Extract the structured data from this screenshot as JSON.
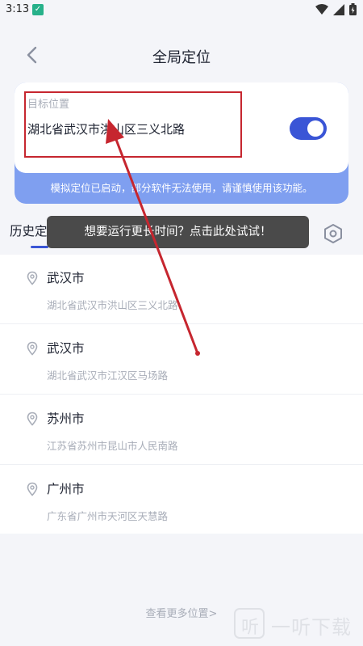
{
  "status_bar": {
    "time": "3:13"
  },
  "header": {
    "title": "全局定位"
  },
  "target": {
    "label": "目标位置",
    "address": "湖北省武汉市洪山区三义北路",
    "toggle_on": true
  },
  "notice": "模拟定位已启动，部分软件无法使用，请谨慎使用该功能。",
  "tabs": {
    "history": "历史定位"
  },
  "tooltip": "想要运行更长时间？点击此处试试！",
  "history": [
    {
      "city": "武汉市",
      "detail": "湖北省武汉市洪山区三义北路"
    },
    {
      "city": "武汉市",
      "detail": "湖北省武汉市江汉区马场路"
    },
    {
      "city": "苏州市",
      "detail": "江苏省苏州市昆山市人民南路"
    },
    {
      "city": "广州市",
      "detail": "广东省广州市天河区天慧路"
    }
  ],
  "more_link": "查看更多位置>",
  "watermark": {
    "icon_char": "听",
    "text": "一听下载"
  },
  "colors": {
    "accent": "#3a55d6",
    "notice_bg": "#7f9ff0",
    "annotation": "#c6262f"
  }
}
